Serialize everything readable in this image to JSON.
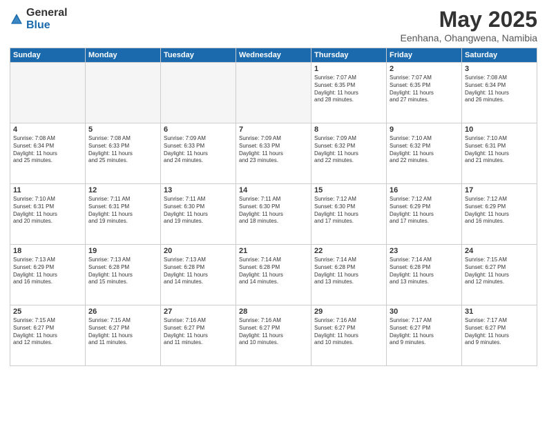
{
  "logo": {
    "general": "General",
    "blue": "Blue"
  },
  "header": {
    "month": "May 2025",
    "location": "Eenhana, Ohangwena, Namibia"
  },
  "days": [
    "Sunday",
    "Monday",
    "Tuesday",
    "Wednesday",
    "Thursday",
    "Friday",
    "Saturday"
  ],
  "weeks": [
    [
      {
        "day": "",
        "text": "",
        "empty": true
      },
      {
        "day": "",
        "text": "",
        "empty": true
      },
      {
        "day": "",
        "text": "",
        "empty": true
      },
      {
        "day": "",
        "text": "",
        "empty": true
      },
      {
        "day": "1",
        "text": "Sunrise: 7:07 AM\nSunset: 6:35 PM\nDaylight: 11 hours\nand 28 minutes."
      },
      {
        "day": "2",
        "text": "Sunrise: 7:07 AM\nSunset: 6:35 PM\nDaylight: 11 hours\nand 27 minutes."
      },
      {
        "day": "3",
        "text": "Sunrise: 7:08 AM\nSunset: 6:34 PM\nDaylight: 11 hours\nand 26 minutes."
      }
    ],
    [
      {
        "day": "4",
        "text": "Sunrise: 7:08 AM\nSunset: 6:34 PM\nDaylight: 11 hours\nand 25 minutes."
      },
      {
        "day": "5",
        "text": "Sunrise: 7:08 AM\nSunset: 6:33 PM\nDaylight: 11 hours\nand 25 minutes."
      },
      {
        "day": "6",
        "text": "Sunrise: 7:09 AM\nSunset: 6:33 PM\nDaylight: 11 hours\nand 24 minutes."
      },
      {
        "day": "7",
        "text": "Sunrise: 7:09 AM\nSunset: 6:33 PM\nDaylight: 11 hours\nand 23 minutes."
      },
      {
        "day": "8",
        "text": "Sunrise: 7:09 AM\nSunset: 6:32 PM\nDaylight: 11 hours\nand 22 minutes."
      },
      {
        "day": "9",
        "text": "Sunrise: 7:10 AM\nSunset: 6:32 PM\nDaylight: 11 hours\nand 22 minutes."
      },
      {
        "day": "10",
        "text": "Sunrise: 7:10 AM\nSunset: 6:31 PM\nDaylight: 11 hours\nand 21 minutes."
      }
    ],
    [
      {
        "day": "11",
        "text": "Sunrise: 7:10 AM\nSunset: 6:31 PM\nDaylight: 11 hours\nand 20 minutes."
      },
      {
        "day": "12",
        "text": "Sunrise: 7:11 AM\nSunset: 6:31 PM\nDaylight: 11 hours\nand 19 minutes."
      },
      {
        "day": "13",
        "text": "Sunrise: 7:11 AM\nSunset: 6:30 PM\nDaylight: 11 hours\nand 19 minutes."
      },
      {
        "day": "14",
        "text": "Sunrise: 7:11 AM\nSunset: 6:30 PM\nDaylight: 11 hours\nand 18 minutes."
      },
      {
        "day": "15",
        "text": "Sunrise: 7:12 AM\nSunset: 6:30 PM\nDaylight: 11 hours\nand 17 minutes."
      },
      {
        "day": "16",
        "text": "Sunrise: 7:12 AM\nSunset: 6:29 PM\nDaylight: 11 hours\nand 17 minutes."
      },
      {
        "day": "17",
        "text": "Sunrise: 7:12 AM\nSunset: 6:29 PM\nDaylight: 11 hours\nand 16 minutes."
      }
    ],
    [
      {
        "day": "18",
        "text": "Sunrise: 7:13 AM\nSunset: 6:29 PM\nDaylight: 11 hours\nand 16 minutes."
      },
      {
        "day": "19",
        "text": "Sunrise: 7:13 AM\nSunset: 6:28 PM\nDaylight: 11 hours\nand 15 minutes."
      },
      {
        "day": "20",
        "text": "Sunrise: 7:13 AM\nSunset: 6:28 PM\nDaylight: 11 hours\nand 14 minutes."
      },
      {
        "day": "21",
        "text": "Sunrise: 7:14 AM\nSunset: 6:28 PM\nDaylight: 11 hours\nand 14 minutes."
      },
      {
        "day": "22",
        "text": "Sunrise: 7:14 AM\nSunset: 6:28 PM\nDaylight: 11 hours\nand 13 minutes."
      },
      {
        "day": "23",
        "text": "Sunrise: 7:14 AM\nSunset: 6:28 PM\nDaylight: 11 hours\nand 13 minutes."
      },
      {
        "day": "24",
        "text": "Sunrise: 7:15 AM\nSunset: 6:27 PM\nDaylight: 11 hours\nand 12 minutes."
      }
    ],
    [
      {
        "day": "25",
        "text": "Sunrise: 7:15 AM\nSunset: 6:27 PM\nDaylight: 11 hours\nand 12 minutes."
      },
      {
        "day": "26",
        "text": "Sunrise: 7:15 AM\nSunset: 6:27 PM\nDaylight: 11 hours\nand 11 minutes."
      },
      {
        "day": "27",
        "text": "Sunrise: 7:16 AM\nSunset: 6:27 PM\nDaylight: 11 hours\nand 11 minutes."
      },
      {
        "day": "28",
        "text": "Sunrise: 7:16 AM\nSunset: 6:27 PM\nDaylight: 11 hours\nand 10 minutes."
      },
      {
        "day": "29",
        "text": "Sunrise: 7:16 AM\nSunset: 6:27 PM\nDaylight: 11 hours\nand 10 minutes."
      },
      {
        "day": "30",
        "text": "Sunrise: 7:17 AM\nSunset: 6:27 PM\nDaylight: 11 hours\nand 9 minutes."
      },
      {
        "day": "31",
        "text": "Sunrise: 7:17 AM\nSunset: 6:27 PM\nDaylight: 11 hours\nand 9 minutes."
      }
    ]
  ]
}
